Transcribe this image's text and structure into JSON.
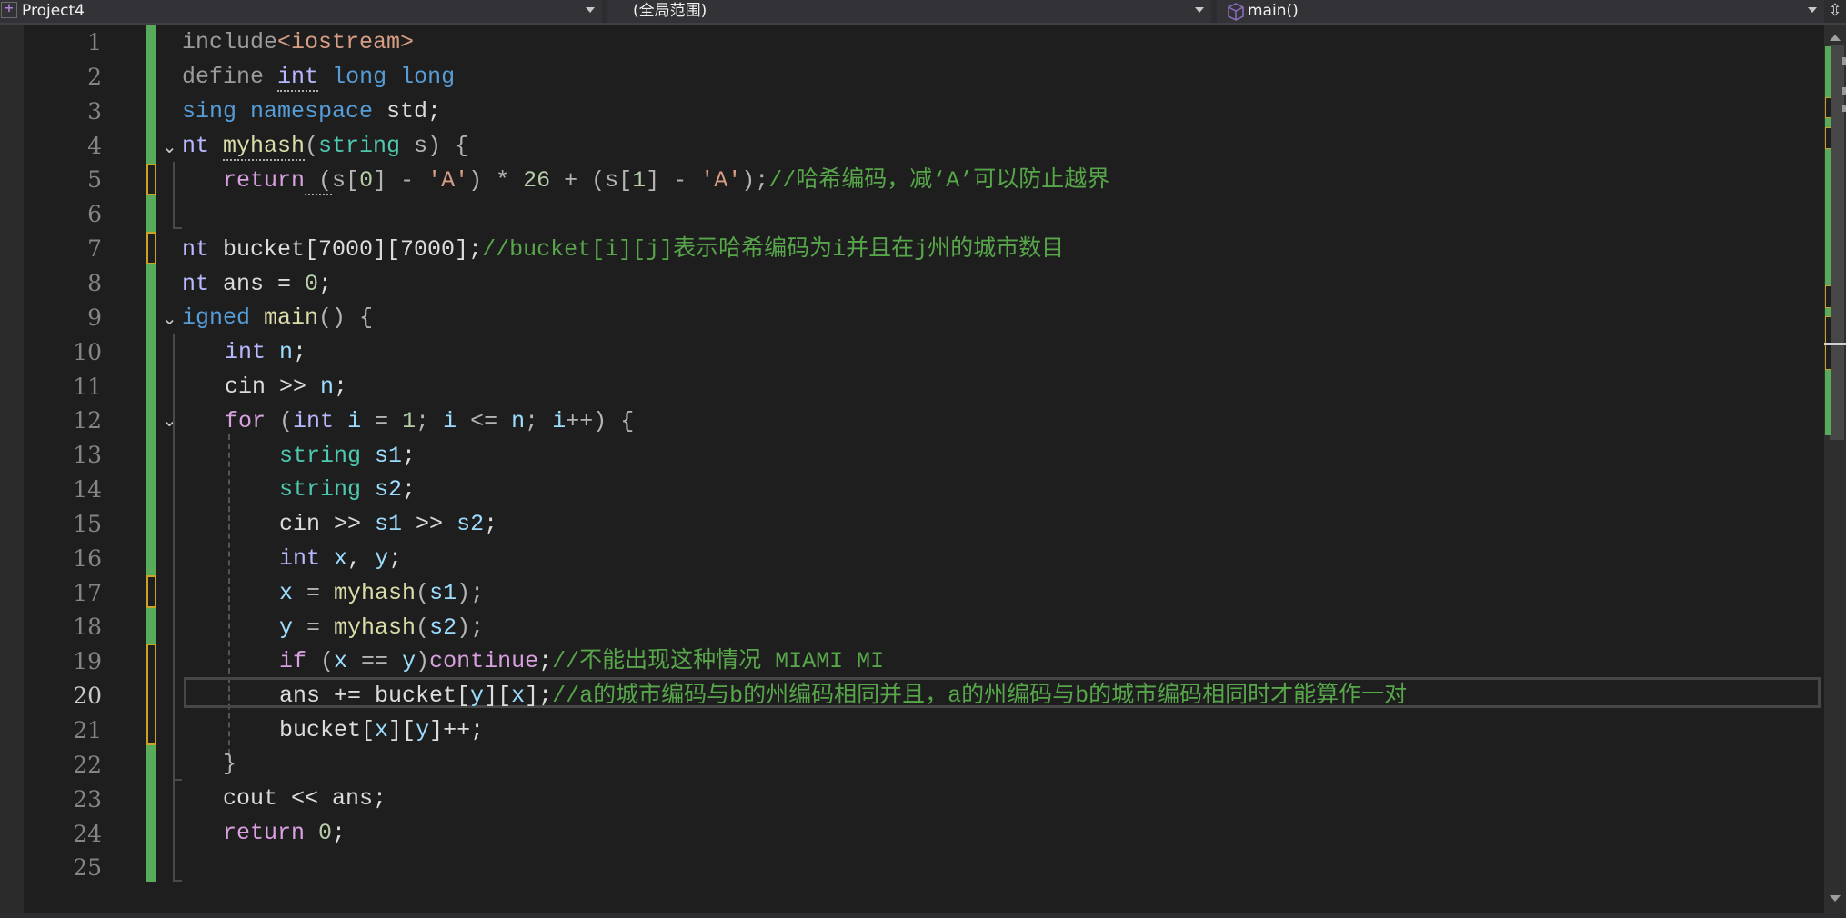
{
  "toolbar": {
    "project_dropdown": "Project4",
    "scope_dropdown": "(全局范围)",
    "member_dropdown": "main()",
    "project_icon": "project-icon",
    "member_icon": "method-cube-icon",
    "split_icon": "split-view-icon"
  },
  "editor": {
    "current_line": 20,
    "lines": [
      {
        "n": "1"
      },
      {
        "n": "2"
      },
      {
        "n": "3"
      },
      {
        "n": "4"
      },
      {
        "n": "5"
      },
      {
        "n": "6"
      },
      {
        "n": "7"
      },
      {
        "n": "8"
      },
      {
        "n": "9"
      },
      {
        "n": "10"
      },
      {
        "n": "11"
      },
      {
        "n": "12"
      },
      {
        "n": "13"
      },
      {
        "n": "14"
      },
      {
        "n": "15"
      },
      {
        "n": "16"
      },
      {
        "n": "17"
      },
      {
        "n": "18"
      },
      {
        "n": "19"
      },
      {
        "n": "20"
      },
      {
        "n": "21"
      },
      {
        "n": "22"
      },
      {
        "n": "23"
      },
      {
        "n": "24"
      },
      {
        "n": "25"
      }
    ],
    "code": {
      "l1": [
        "include",
        "<iostream>"
      ],
      "l2": [
        "define ",
        "int",
        " ",
        "long long"
      ],
      "l3": [
        "sing namespace",
        " std;"
      ],
      "l4": [
        "nt ",
        "myhash",
        "(",
        "string",
        " s) {"
      ],
      "l5": [
        "return",
        " (",
        "s",
        "[",
        "0",
        "] - ",
        "'A'",
        ") * ",
        "26",
        " + (",
        "s",
        "[",
        "1",
        "] - ",
        "'A'",
        ");",
        "//哈希编码，减‘A’可以防止越界"
      ],
      "l7": [
        "nt ",
        "bucket[7000][7000];",
        "//bucket[i][j]表示哈希编码为i并且在j州的城市数目"
      ],
      "l8": [
        "nt ",
        "ans = ",
        "0",
        ";"
      ],
      "l9": [
        "igned",
        " ",
        "main",
        "() {"
      ],
      "l10": [
        "int",
        " ",
        "n",
        ";"
      ],
      "l11": [
        "cin >> ",
        "n",
        ";"
      ],
      "l12": [
        "for",
        " (",
        "int",
        " ",
        "i",
        " = ",
        "1",
        "; ",
        "i",
        " <= ",
        "n",
        "; ",
        "i",
        "++) {"
      ],
      "l13": [
        "string",
        " ",
        "s1",
        ";"
      ],
      "l14": [
        "string",
        " ",
        "s2",
        ";"
      ],
      "l15": [
        "cin >> ",
        "s1",
        " >> ",
        "s2",
        ";"
      ],
      "l16": [
        "int",
        " ",
        "x",
        ", ",
        "y",
        ";"
      ],
      "l17": [
        "x",
        " = ",
        "myhash",
        "(",
        "s1",
        ");"
      ],
      "l18": [
        "y",
        " = ",
        "myhash",
        "(",
        "s2",
        ");"
      ],
      "l19": [
        "if",
        " (",
        "x",
        " == ",
        "y",
        ")",
        "continue",
        ";",
        "//不能出现这种情况 MIAMI MI"
      ],
      "l20": [
        "ans += bucket[",
        "y",
        "][",
        "x",
        "];",
        "//a的城市编码与b的州编码相同并且，a的州编码与b的城市编码相同时才能算作一对"
      ],
      "l21": [
        "bucket[",
        "x",
        "][",
        "y",
        "]++;"
      ],
      "l22": [
        "}"
      ],
      "l23": [
        "cout << ans;"
      ],
      "l24": [
        "return",
        " ",
        "0",
        ";"
      ]
    }
  },
  "colors": {
    "background": "#1e1e1e",
    "keyword": "#569cd6",
    "control": "#d8a0df",
    "type": "#4ec9b0",
    "function": "#dcdcaa",
    "variable": "#9cdcfe",
    "number": "#b5cea8",
    "string": "#d69d85",
    "comment": "#57a64a",
    "change_saved": "#57ab5a",
    "change_unsaved": "#c9a227"
  }
}
